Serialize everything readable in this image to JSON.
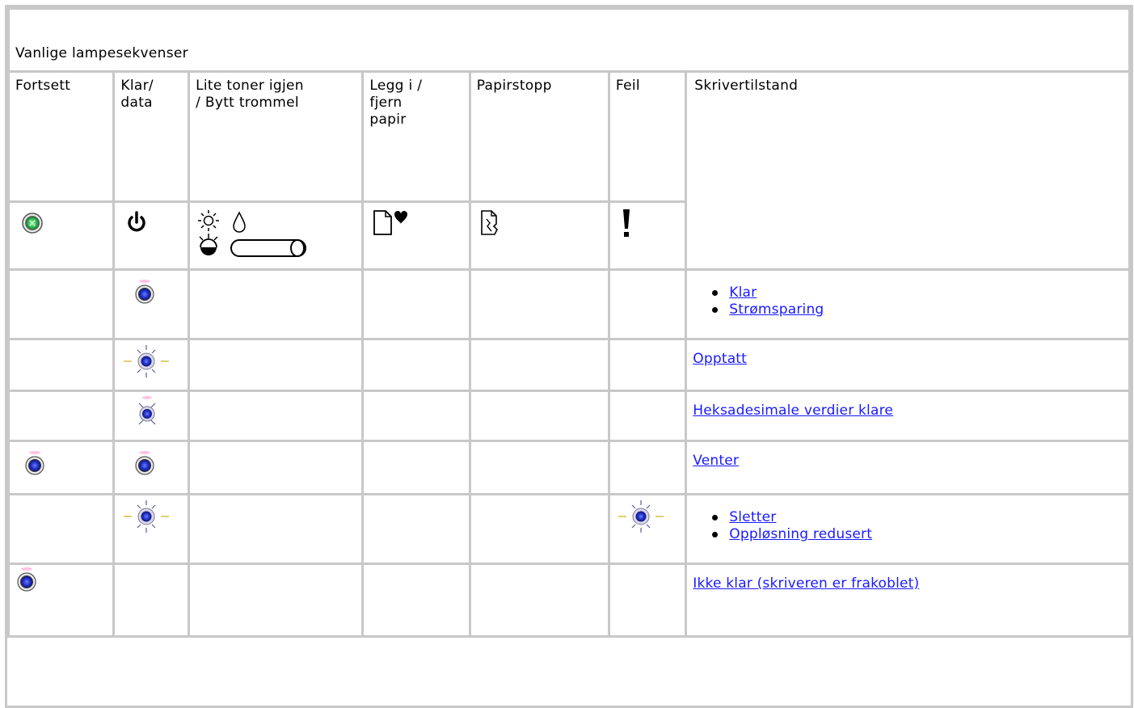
{
  "caption": "Vanlige lampesekvenser",
  "columns": [
    {
      "id": "fortsett",
      "label": "Fortsett",
      "icon": "continue-light-icon"
    },
    {
      "id": "klar",
      "label": "Klar/ data",
      "icon": "power-ready-icon"
    },
    {
      "id": "toner",
      "label": "Lite toner igjen / Bytt trommel",
      "icon": "toner-drum-icon"
    },
    {
      "id": "papir",
      "label": "Legg i / fjern papir",
      "icon": "load-paper-icon"
    },
    {
      "id": "stopp",
      "label": "Papirstopp",
      "icon": "paper-jam-icon"
    },
    {
      "id": "feil",
      "label": "Feil",
      "icon": "error-exclamation-icon"
    },
    {
      "id": "tilstand",
      "label": "Skrivertilstand"
    }
  ],
  "rows": [
    {
      "lights": {
        "klar": "on"
      },
      "states": [
        "Klar",
        "Strømsparing"
      ]
    },
    {
      "lights": {
        "klar": "blink"
      },
      "states": [
        "Opptatt"
      ]
    },
    {
      "lights": {
        "klar": "blink-small"
      },
      "states": [
        "Heksadesimale verdier klare"
      ]
    },
    {
      "lights": {
        "fortsett": "on",
        "klar": "on"
      },
      "states": [
        "Venter"
      ]
    },
    {
      "lights": {
        "klar": "blink",
        "feil": "blink"
      },
      "states": [
        "Sletter",
        "Oppløsning redusert"
      ]
    },
    {
      "lights": {
        "fortsett": "on"
      },
      "states": [
        "Ikke klar (skriveren er frakoblet)"
      ]
    }
  ],
  "colors": {
    "border": "#c8c8c8",
    "link": "#1a1aff",
    "light_on": "#2233cc",
    "continue_light": "#33bb55"
  }
}
